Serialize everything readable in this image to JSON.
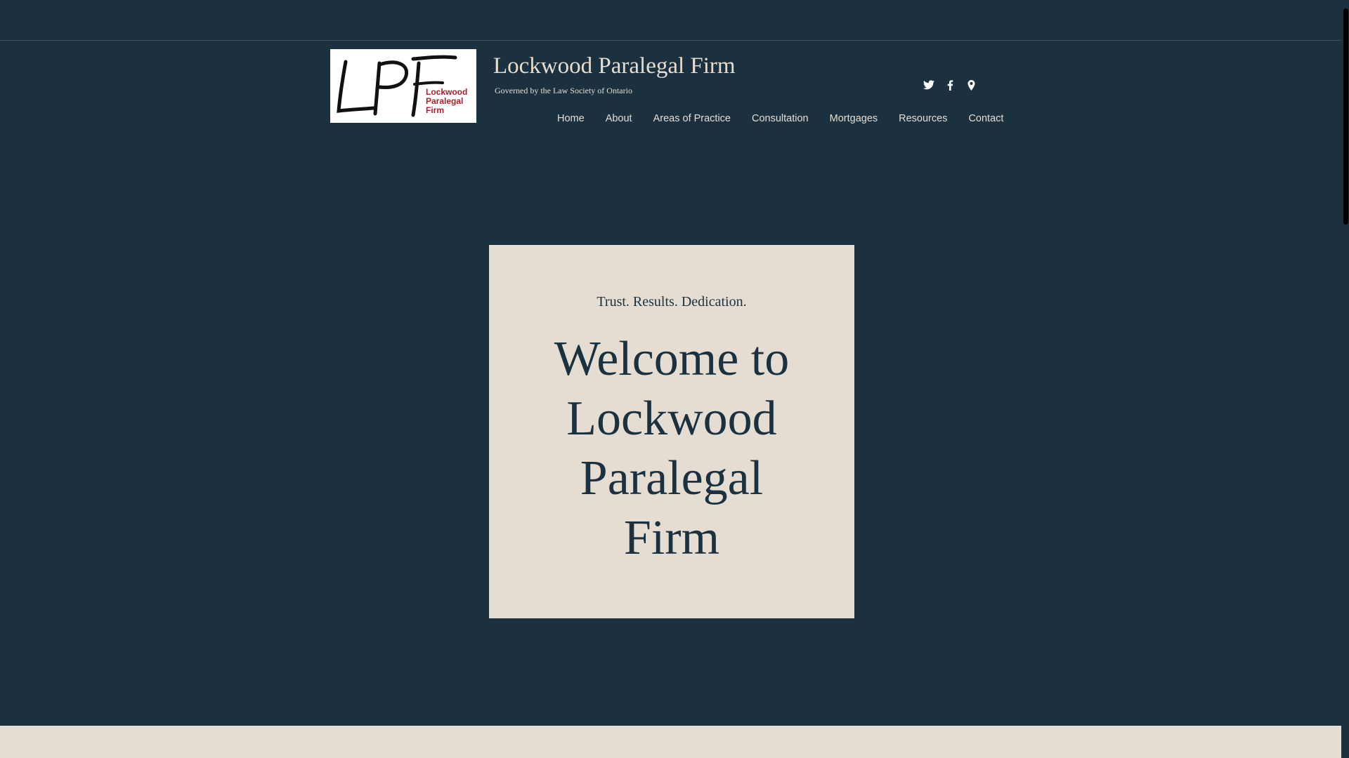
{
  "header": {
    "site_title": "Lockwood Paralegal Firm",
    "tagline": "Governed by the Law Society of Ontario",
    "logo": {
      "monogram": "LPF",
      "line1": "Lockwood",
      "line2": "Paralegal",
      "line3": "Firm"
    },
    "social": [
      {
        "icon": "twitter-icon"
      },
      {
        "icon": "facebook-icon"
      },
      {
        "icon": "map-pin-icon"
      }
    ]
  },
  "nav": {
    "items": [
      {
        "label": "Home"
      },
      {
        "label": "About"
      },
      {
        "label": "Areas of Practice"
      },
      {
        "label": "Consultation"
      },
      {
        "label": "Mortgages"
      },
      {
        "label": "Resources"
      },
      {
        "label": "Contact"
      }
    ]
  },
  "hero": {
    "tagline": "Trust. Results. Dedication.",
    "heading": "Welcome to Lockwood Paralegal Firm"
  },
  "colors": {
    "background": "#1b3140",
    "card": "#e5ddd1",
    "text_light": "#e6ddd1",
    "text_dark": "#1b3140",
    "logo_accent": "#a8202a"
  }
}
